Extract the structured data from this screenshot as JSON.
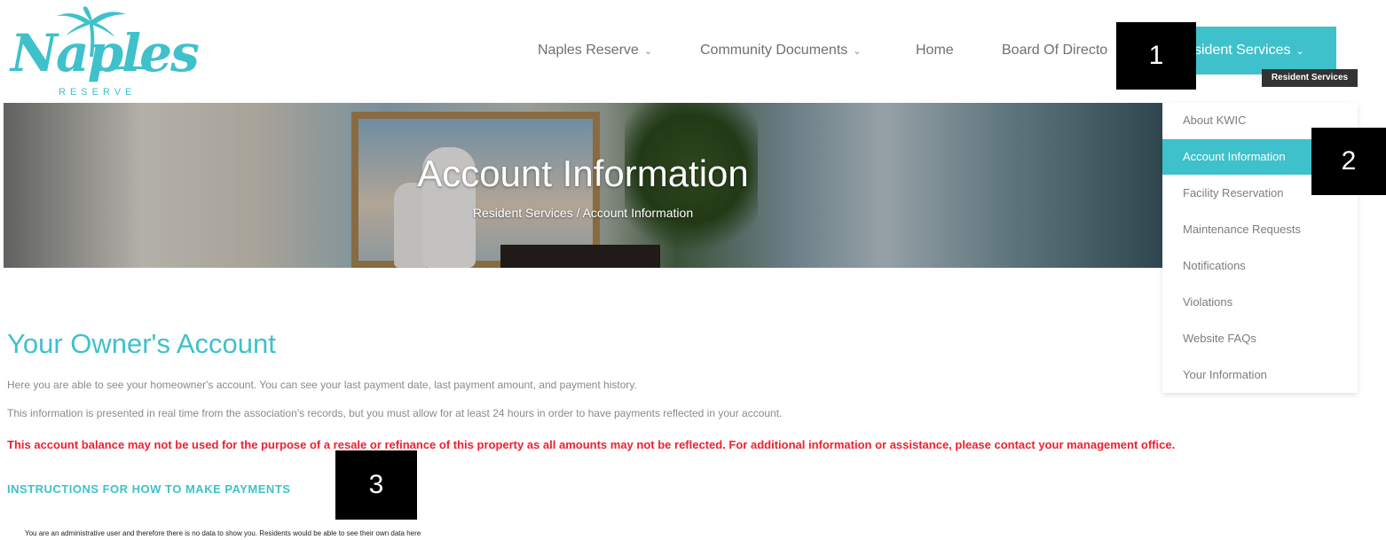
{
  "logo": {
    "word": "Naples",
    "sub": "RESERVE"
  },
  "nav": {
    "items": [
      {
        "label": "Naples Reserve",
        "has_menu": true
      },
      {
        "label": "Community Documents",
        "has_menu": true
      },
      {
        "label": "Home",
        "has_menu": false
      },
      {
        "label": "Board Of Directo",
        "has_menu": false
      }
    ],
    "active": {
      "label": "sident Services",
      "has_menu": true
    },
    "tooltip": "Resident Services"
  },
  "hero": {
    "title": "Account Information",
    "breadcrumb": "Resident Services / Account Information"
  },
  "dropdown": {
    "items": [
      {
        "label": "About KWIC",
        "active": false
      },
      {
        "label": "Account Information",
        "active": true
      },
      {
        "label": "Facility Reservation",
        "active": false
      },
      {
        "label": "Maintenance Requests",
        "active": false
      },
      {
        "label": "Notifications",
        "active": false
      },
      {
        "label": "Violations",
        "active": false
      },
      {
        "label": "Website FAQs",
        "active": false
      },
      {
        "label": "Your Information",
        "active": false
      }
    ]
  },
  "content": {
    "title": "Your Owner's Account",
    "para1": "Here you are able to see your homeowner's account.  You can see your last payment date, last payment amount, and payment history.",
    "para2": "This information is presented in real time from the association's records, but you must allow for at least 24 hours in order to have payments reflected in your account.",
    "warning": "This account balance may not be used for the purpose of a resale or refinance of this property as all amounts may not be reflected. For additional information or assistance, please contact your management office.",
    "instructions_link": "INSTRUCTIONS FOR HOW TO MAKE PAYMENTS",
    "admin_note": "You are an administrative user and therefore there is no data to show you. Residents would be able to see their own data here"
  },
  "badges": [
    "1",
    "2",
    "3"
  ],
  "colors": {
    "accent": "#3fc1cb",
    "warning": "#f0202e",
    "badge": "#000000"
  },
  "icons": {
    "menu_chevron": "chevron-down-icon",
    "logo_tree": "palm-tree-icon"
  }
}
